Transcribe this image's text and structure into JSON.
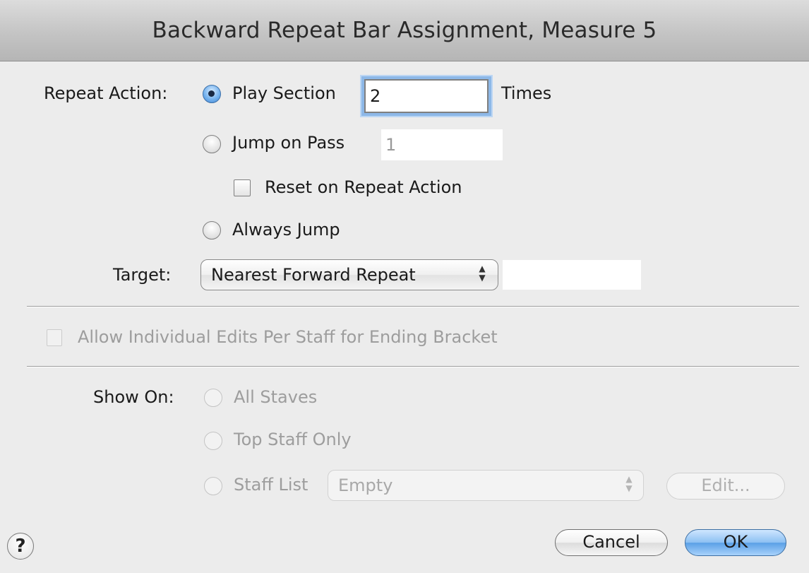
{
  "title": "Backward Repeat Bar Assignment, Measure 5",
  "repeat_action": {
    "label": "Repeat Action:",
    "play_section": {
      "label": "Play Section",
      "value": "2",
      "suffix": "Times",
      "selected": true
    },
    "jump_on_pass": {
      "label": "Jump on Pass",
      "value": "1",
      "selected": false
    },
    "reset_on_repeat": {
      "label": "Reset on Repeat Action",
      "checked": false
    },
    "always_jump": {
      "label": "Always Jump",
      "selected": false
    }
  },
  "target": {
    "label": "Target:",
    "selected": "Nearest Forward Repeat",
    "value": ""
  },
  "allow_individual_edits": {
    "label": "Allow Individual Edits Per Staff for Ending Bracket",
    "checked": false,
    "enabled": false
  },
  "show_on": {
    "label": "Show On:",
    "all_staves": "All Staves",
    "top_staff_only": "Top Staff Only",
    "staff_list": "Staff List",
    "staff_list_value": "Empty",
    "edit_label": "Edit..."
  },
  "buttons": {
    "help": "?",
    "cancel": "Cancel",
    "ok": "OK"
  }
}
